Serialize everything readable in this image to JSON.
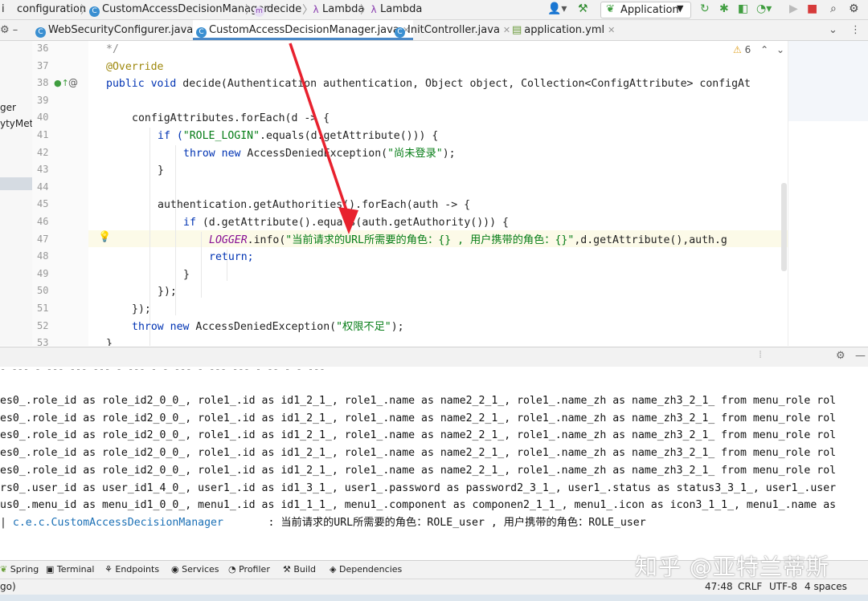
{
  "breadcrumb": {
    "items": [
      {
        "label": "configuration",
        "icon": ""
      },
      {
        "label": "CustomAccessDecisionManager",
        "icon": "class-icon"
      },
      {
        "label": "decide",
        "icon": "method-icon"
      },
      {
        "label": "Lambda",
        "icon": "lambda-icon"
      },
      {
        "label": "Lambda",
        "icon": "lambda-icon"
      }
    ]
  },
  "toolbar": {
    "run_config": "Application"
  },
  "tabs": [
    {
      "label": "WebSecurityConfigurer.java",
      "active": false
    },
    {
      "label": "CustomAccessDecisionManager.java",
      "active": true
    },
    {
      "label": "InitController.java",
      "active": false
    },
    {
      "label": "application.yml",
      "active": false
    }
  ],
  "left_panel": {
    "fragment1": "ger",
    "fragment2": "ytyMeta"
  },
  "inspections": {
    "warnings": "6"
  },
  "line_numbers": [
    "36",
    "37",
    "38",
    "39",
    "40",
    "41",
    "42",
    "43",
    "44",
    "45",
    "46",
    "47",
    "48",
    "49",
    "50",
    "51",
    "52",
    "53"
  ],
  "code": {
    "l36": "*/",
    "l37": "@Override",
    "l38_a": "public void ",
    "l38_b": "decide(Authentication authentication, Object object, Collection<ConfigAttribute> configAt",
    "l40": "configAttributes.forEach(d -> {",
    "l41_a": "if (",
    "l41_b": "\"ROLE_LOGIN\"",
    "l41_c": ".equals(d.getAttribute())) {",
    "l42_a": "throw new ",
    "l42_b": "AccessDeniedException(",
    "l42_c": "\"尚未登录\"",
    "l42_d": ");",
    "l43": "}",
    "l45": "authentication.getAuthorities().forEach(auth -> {",
    "l46_a": "if ",
    "l46_b": "(d.getAttribute().equals(auth.getAuthority())) {",
    "l47_a": "LOGGER",
    "l47_b": ".info(",
    "l47_c": "\"当前请求的URL所需要的角色：{} , 用户携带的角色：{}\"",
    "l47_d": ",d.getAttribute(),auth.g",
    "l48": "return;",
    "l49": "}",
    "l50": "});",
    "l51": "});",
    "l52_a": "throw new ",
    "l52_b": "AccessDeniedException(",
    "l52_c": "\"权限不足\"",
    "l52_d": ");",
    "l53": "}"
  },
  "console_lines": [
    "es0_.role_id as role_id2_0_0_, role1_.id as id1_2_1_, role1_.name as name2_2_1_, role1_.name_zh as name_zh3_2_1_ from menu_role rol",
    "es0_.role_id as role_id2_0_0_, role1_.id as id1_2_1_, role1_.name as name2_2_1_, role1_.name_zh as name_zh3_2_1_ from menu_role rol",
    "es0_.role_id as role_id2_0_0_, role1_.id as id1_2_1_, role1_.name as name2_2_1_, role1_.name_zh as name_zh3_2_1_ from menu_role rol",
    "es0_.role_id as role_id2_0_0_, role1_.id as id1_2_1_, role1_.name as name2_2_1_, role1_.name_zh as name_zh3_2_1_ from menu_role rol",
    "es0_.role_id as role_id2_0_0_, role1_.id as id1_2_1_, role1_.name as name2_2_1_, role1_.name_zh as name_zh3_2_1_ from menu_role rol",
    "rs0_.user_id as user_id1_4_0_, user1_.id as id1_3_1_, user1_.password as password2_3_1_, user1_.status as status3_3_1_, user1_.user",
    "us0_.menu_id as menu_id1_0_0_, menu1_.id as id1_1_1_, menu1_.component as componen2_1_1_, menu1_.icon as icon3_1_1_, menu1_.name as"
  ],
  "console_log": {
    "prefix": "| ",
    "logger": "c.e.c.CustomAccessDecisionManager",
    "message": "       : 当前请求的URL所需要的角色：ROLE_user , 用户携带的角色：ROLE_user"
  },
  "tool_windows": [
    "Spring",
    "Terminal",
    "Endpoints",
    "Services",
    "Profiler",
    "Build",
    "Dependencies"
  ],
  "status": {
    "left": "go)",
    "position": "47:48",
    "line_sep": "CRLF",
    "encoding": "UTF-8",
    "indent": "4 spaces"
  },
  "watermark": "知乎 @亚特兰蒂斯",
  "colors": {
    "keyword": "#0033b3",
    "string": "#067d17",
    "annotation": "#9e880d",
    "static_field": "#871094",
    "arrow": "#e8212e"
  }
}
